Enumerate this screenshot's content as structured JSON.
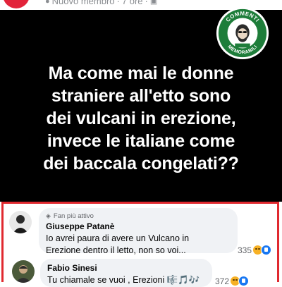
{
  "header": {
    "author_meta": "Nuovo membro",
    "separator": "·",
    "time": "7 ore",
    "privacy_icon": "group-icon"
  },
  "post": {
    "text": "Ma come mai le donne\nstraniere all'etto sono\ndei vulcani in erezione,\ninvece le italiane come\ndei baccala congelati??",
    "background_color": "#000000",
    "text_color": "#ffffff"
  },
  "logo": {
    "text_top": "COMMENTI",
    "text_bottom": "MEMORABILI",
    "icon": "logo-emblem-icon",
    "color": "#1e7d3a"
  },
  "comments": [
    {
      "badge": "Fan più attivo",
      "badge_icon": "fan-badge-icon",
      "name": "Giuseppe Patanè",
      "text": "Io avrei paura di avere un Vulcano in\nErezione dentro il letto, non so voi...",
      "reaction_count": "335",
      "reaction_icons": [
        "haha-icon",
        "like-icon"
      ]
    },
    {
      "name": "Fabio Sinesi",
      "text": "Tu chiamale se vuoi , Erezioni 🎼🎵🎶",
      "reaction_count": "372",
      "reaction_icons": [
        "haha-icon",
        "like-icon"
      ]
    }
  ],
  "accent_color": "#e0292f"
}
